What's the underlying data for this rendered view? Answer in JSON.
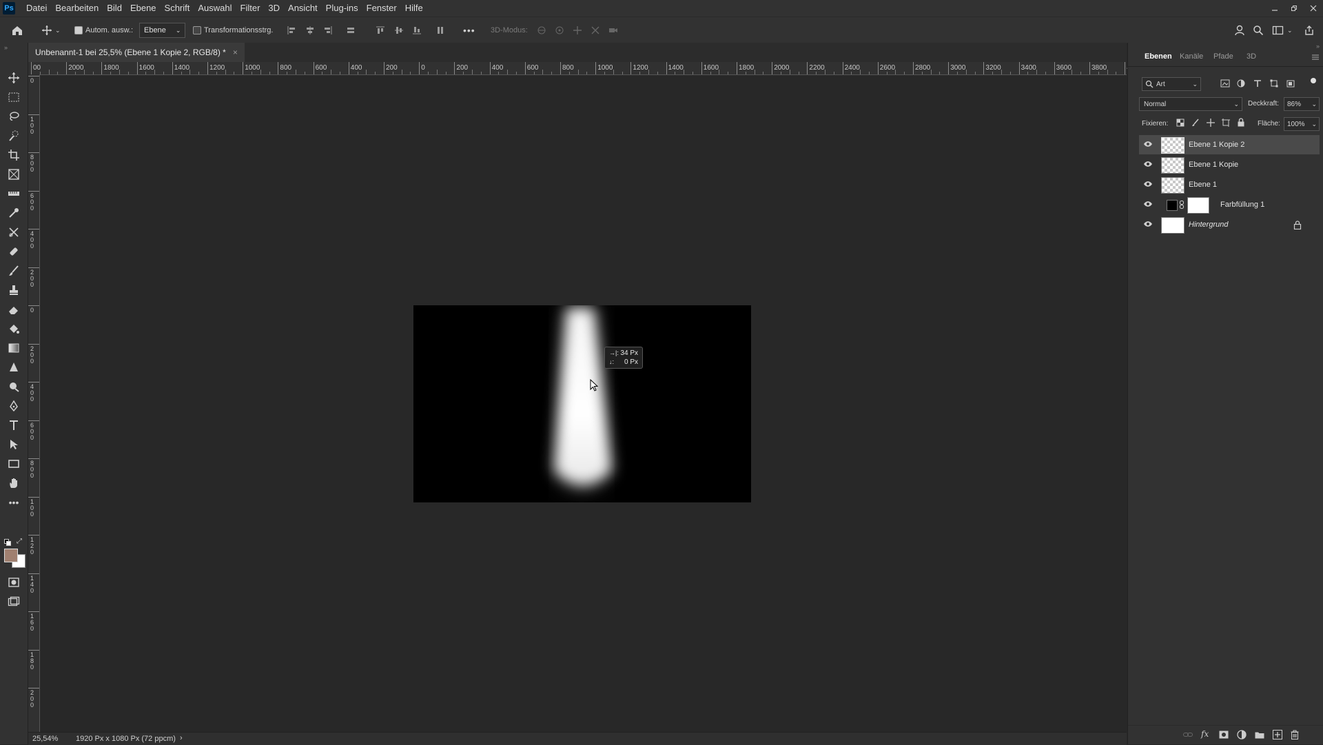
{
  "menu": [
    "Datei",
    "Bearbeiten",
    "Bild",
    "Ebene",
    "Schrift",
    "Auswahl",
    "Filter",
    "3D",
    "Ansicht",
    "Plug-ins",
    "Fenster",
    "Hilfe"
  ],
  "app_logo": "Ps",
  "options": {
    "auto_select_label": "Autom. ausw.:",
    "auto_select_target": "Ebene",
    "transform_label": "Transformationsstrg.",
    "more": "•••",
    "mode_3d": "3D-Modus:"
  },
  "document": {
    "tab_title": "Unbenannt-1 bei 25,5% (Ebene 1 Kopie 2, RGB/8) *",
    "close": "×"
  },
  "ruler": {
    "h_labels": [
      "00",
      "2000",
      "1800",
      "1600",
      "1400",
      "1200",
      "1000",
      "800",
      "600",
      "400",
      "200",
      "0",
      "200",
      "400",
      "600",
      "800",
      "1000",
      "1200",
      "1400",
      "1600",
      "1800",
      "2000",
      "2200",
      "2400",
      "2600",
      "2800",
      "3000",
      "3200",
      "3400",
      "3600",
      "3800",
      "4"
    ],
    "v_labels": [
      "0",
      "1\n0\n0",
      "8\n0\n0",
      "6\n0\n0",
      "4\n0\n0",
      "2\n0\n0",
      "0",
      "2\n0\n0",
      "4\n0\n0",
      "6\n0\n0",
      "8\n0\n0",
      "1\n0\n0",
      "1\n2\n0",
      "1\n4\n0",
      "1\n6\n0",
      "1\n8\n0",
      "2\n0\n0"
    ]
  },
  "tooltip": {
    "dx": "34 Px",
    "dy": "0 Px"
  },
  "status": {
    "zoom": "25,54%",
    "size": "1920 Px x 1080 Px (72 ppcm)",
    "arrow": "›"
  },
  "panel": {
    "tabs": [
      "Ebenen",
      "Kanäle",
      "Pfade",
      "3D"
    ],
    "filter_kind": "Art",
    "blend_mode": "Normal",
    "opacity_label": "Deckkraft:",
    "opacity_value": "86%",
    "lock_label": "Fixieren:",
    "fill_label": "Fläche:",
    "fill_value": "100%",
    "layers": [
      {
        "name": "Ebene 1 Kopie 2",
        "selected": true
      },
      {
        "name": "Ebene 1 Kopie",
        "selected": false
      },
      {
        "name": "Ebene 1",
        "selected": false
      },
      {
        "name": "Farbfüllung 1",
        "selected": false
      },
      {
        "name": "Hintergrund",
        "selected": false,
        "locked": true
      }
    ]
  },
  "colors": {
    "foreground": "#a08070",
    "background": "#ffffff",
    "ui_bg": "#323232",
    "canvas_bg": "#282828"
  }
}
